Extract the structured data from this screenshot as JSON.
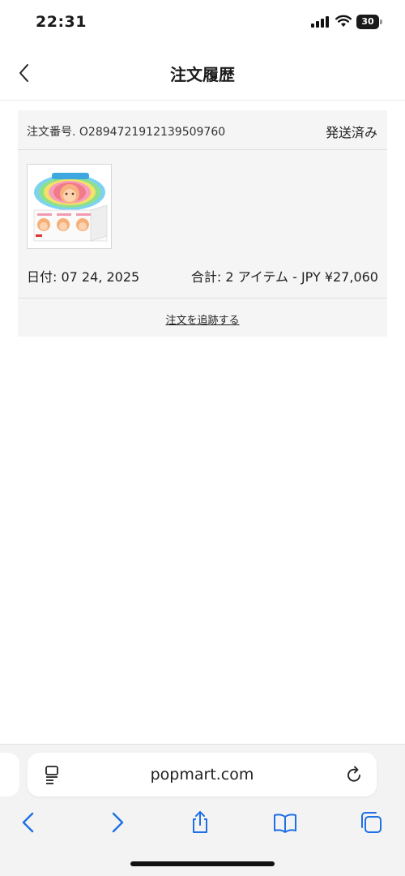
{
  "status_bar": {
    "time": "22:31",
    "battery": "30"
  },
  "header": {
    "title": "注文履歴"
  },
  "order": {
    "number_label": "注文番号. O2894721912139509760",
    "status": "発送済み",
    "date": "日付: 07 24, 2025",
    "total": "合計: 2 アイテム -  JPY ¥27,060",
    "track_label": "注文を追跡する"
  },
  "browser": {
    "url": "popmart.com"
  },
  "colors": {
    "accent": "#1f6fe5",
    "card_bg": "#f5f5f5"
  }
}
